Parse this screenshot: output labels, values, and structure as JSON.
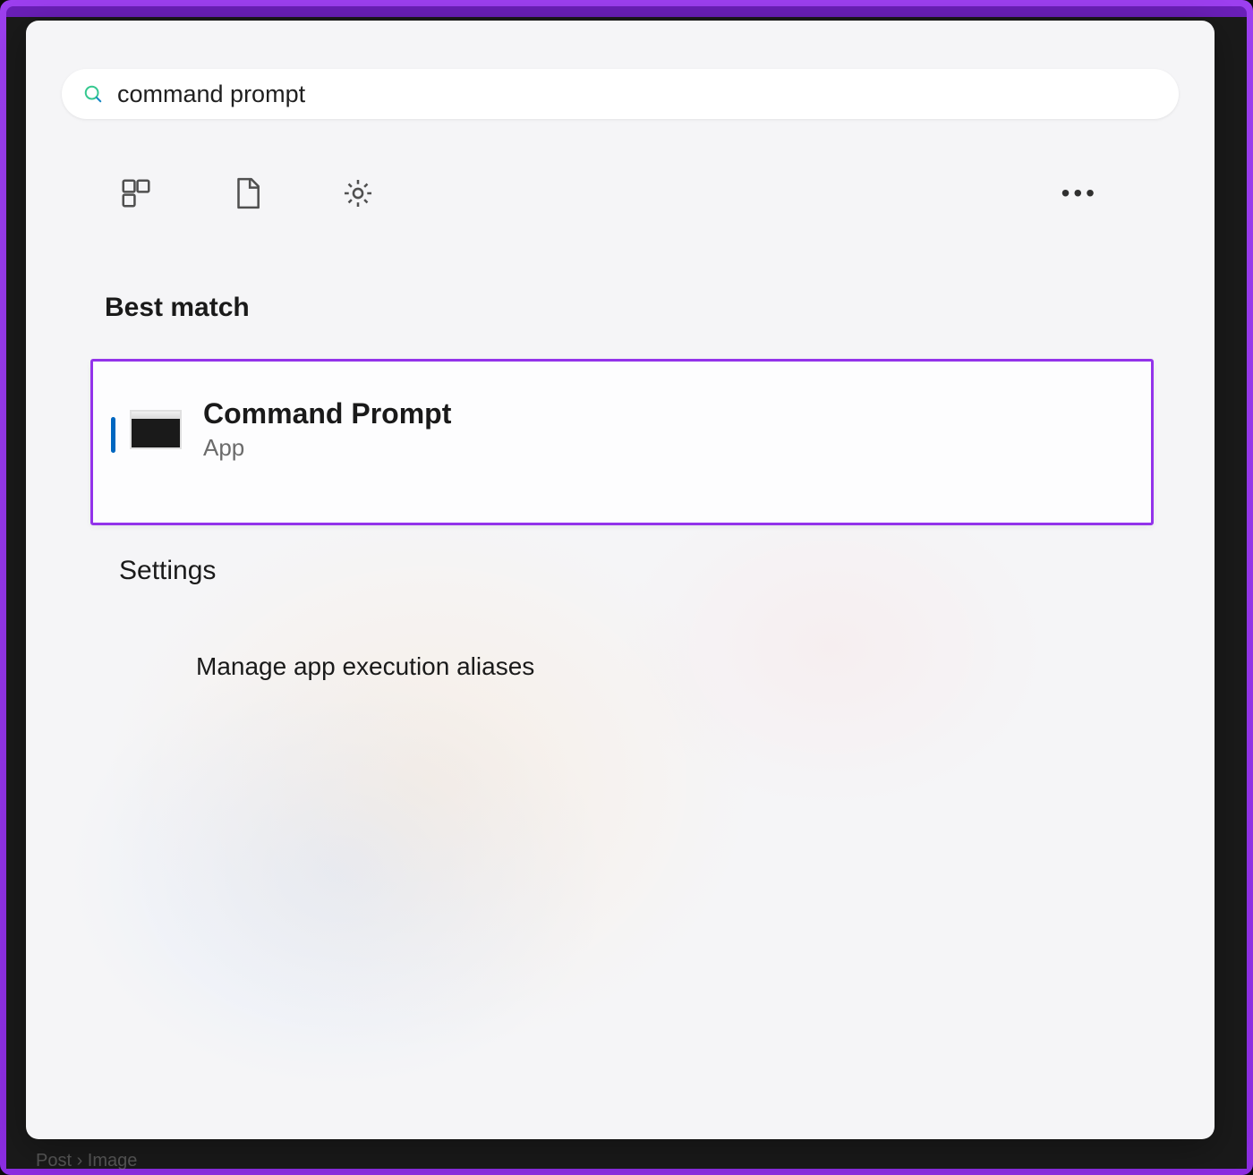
{
  "search": {
    "value": "command prompt"
  },
  "sections": {
    "best_match_label": "Best match",
    "settings_label": "Settings"
  },
  "best_match": {
    "title": "Command Prompt",
    "subtitle": "App"
  },
  "settings_results": {
    "item1": "Manage app execution aliases"
  },
  "icons": {
    "apps": "apps-icon",
    "documents": "document-icon",
    "settings": "gear-icon",
    "more": "more-icon",
    "search": "search-icon"
  },
  "faint": {
    "bottom": "Post › Image"
  },
  "colors": {
    "highlight_border": "#9333ea",
    "accent": "#0067c0"
  }
}
